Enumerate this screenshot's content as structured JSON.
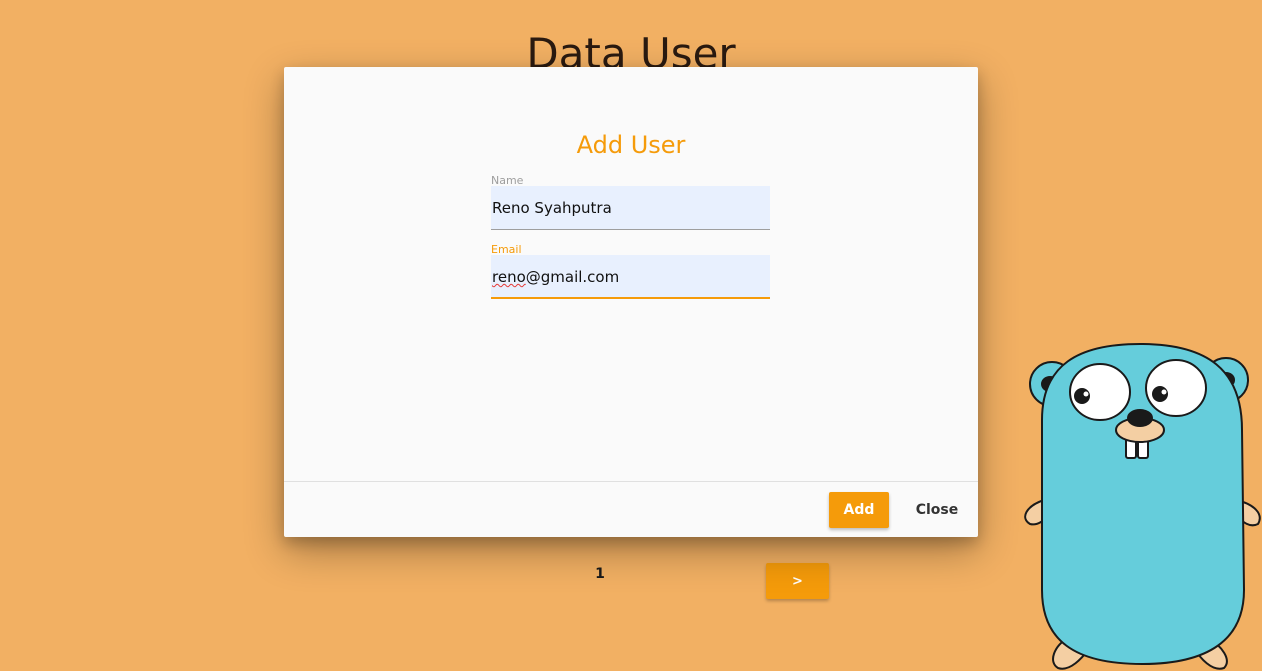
{
  "page": {
    "title": "Data User"
  },
  "pagination": {
    "current_page": "1",
    "next_label": ">"
  },
  "modal": {
    "title": "Add User",
    "fields": {
      "name": {
        "label": "Name",
        "value": "Reno Syahputra"
      },
      "email": {
        "label": "Email",
        "value_misspelled_part": "reno",
        "value_rest": "@gmail.com"
      }
    },
    "buttons": {
      "add_label": "Add",
      "close_label": "Close"
    }
  },
  "mascot": {
    "icon": "gopher-mascot-icon"
  },
  "colors": {
    "background": "#f2b063",
    "accent": "#f59b0a",
    "input_fill": "#e8f0fe",
    "gopher_body": "#65cddb"
  }
}
